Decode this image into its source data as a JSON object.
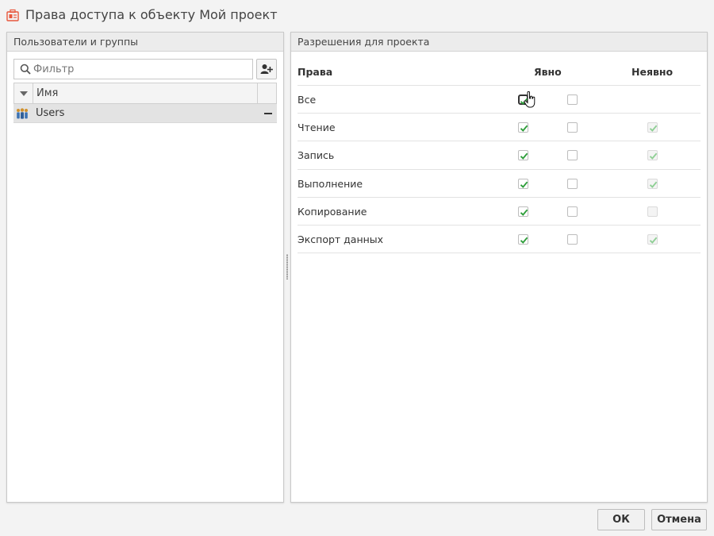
{
  "window": {
    "title": "Права доступа к объекту Мой проект"
  },
  "left_panel": {
    "title": "Пользователи и группы",
    "filter_placeholder": "Фильтр",
    "grid": {
      "column_name": "Имя",
      "rows": [
        {
          "label": "Users",
          "selected": true
        }
      ]
    }
  },
  "right_panel": {
    "title": "Разрешения для проекта",
    "headers": {
      "rights": "Права",
      "explicit": "Явно",
      "implicit": "Неявно"
    },
    "rows": [
      {
        "label": "Все",
        "allow": true,
        "deny": false,
        "implicit": null
      },
      {
        "label": "Чтение",
        "allow": true,
        "deny": false,
        "implicit": true
      },
      {
        "label": "Запись",
        "allow": true,
        "deny": false,
        "implicit": true
      },
      {
        "label": "Выполнение",
        "allow": true,
        "deny": false,
        "implicit": true
      },
      {
        "label": "Копирование",
        "allow": true,
        "deny": false,
        "implicit": false
      },
      {
        "label": "Экспорт данных",
        "allow": true,
        "deny": false,
        "implicit": true
      }
    ]
  },
  "footer": {
    "ok_label": "ОК",
    "cancel_label": "Отмена"
  },
  "colors": {
    "check_green": "#2e9e3a",
    "implicit_check": "#8fcf95",
    "title_icon": "#e8573c"
  },
  "icons": [
    "project-icon",
    "search-icon",
    "add-user-icon",
    "sort-arrow-icon",
    "users-group-icon",
    "remove-icon",
    "hand-cursor-icon"
  ]
}
